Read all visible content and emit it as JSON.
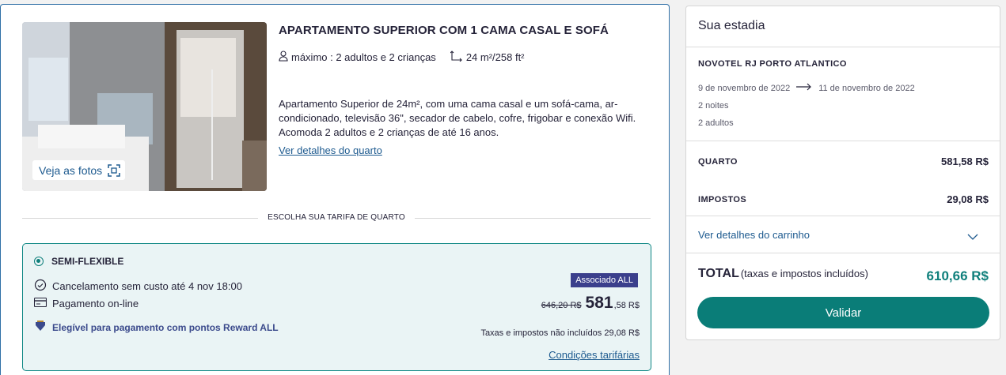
{
  "room": {
    "title": "APARTAMENTO SUPERIOR COM 1 CAMA CASAL E SOFÁ",
    "capacity": "máximo : 2 adultos e 2 crianças",
    "size": "24 m²/258 ft²",
    "description": "Apartamento Superior de 24m², com uma cama casal e um sofá-cama, ar-condicionado, televisão 36\", secador de cabelo, cofre, frigobar e conexão Wifi. Acomoda 2 adultos e 2 crianças de até 16 anos.",
    "details_link": "Ver detalhes do quarto",
    "photos_button": "Veja as fotos"
  },
  "rate_section_label": "ESCOLHA SUA TARIFA DE QUARTO",
  "rate": {
    "name": "SEMI-FLEXIBLE",
    "cancellation": "Cancelamento sem custo até 4 nov 18:00",
    "payment": "Pagamento on-line",
    "reward": "Elegível para pagamento com pontos Reward ALL",
    "badge": "Associado ALL",
    "old_price": "646,20 R$",
    "price_integer": "581",
    "price_cents": ",58 R$",
    "tax_note": "Taxas e impostos não incluídos 29,08 R$",
    "conditions_link": "Condições tarifárias"
  },
  "summary": {
    "title": "Sua estadia",
    "hotel": "NOVOTEL RJ PORTO ATLANTICO",
    "check_in": "9 de novembro de 2022",
    "check_out": "11 de novembro de 2022",
    "nights": "2 noites",
    "guests": "2 adultos",
    "room_label": "QUARTO",
    "room_value": "581,58 R$",
    "taxes_label": "IMPOSTOS",
    "taxes_value": "29,08 R$",
    "cart_link": "Ver detalhes do carrinho",
    "total_label": "TOTAL",
    "total_sub": "(taxas e impostos incluídos)",
    "total_value": "610,66 R$",
    "validate_button": "Validar"
  },
  "colors": {
    "accent": "#0a7d78",
    "link": "#1d5a8f",
    "badge": "#3b3f8c",
    "rate_bg": "#eaf4f5"
  }
}
